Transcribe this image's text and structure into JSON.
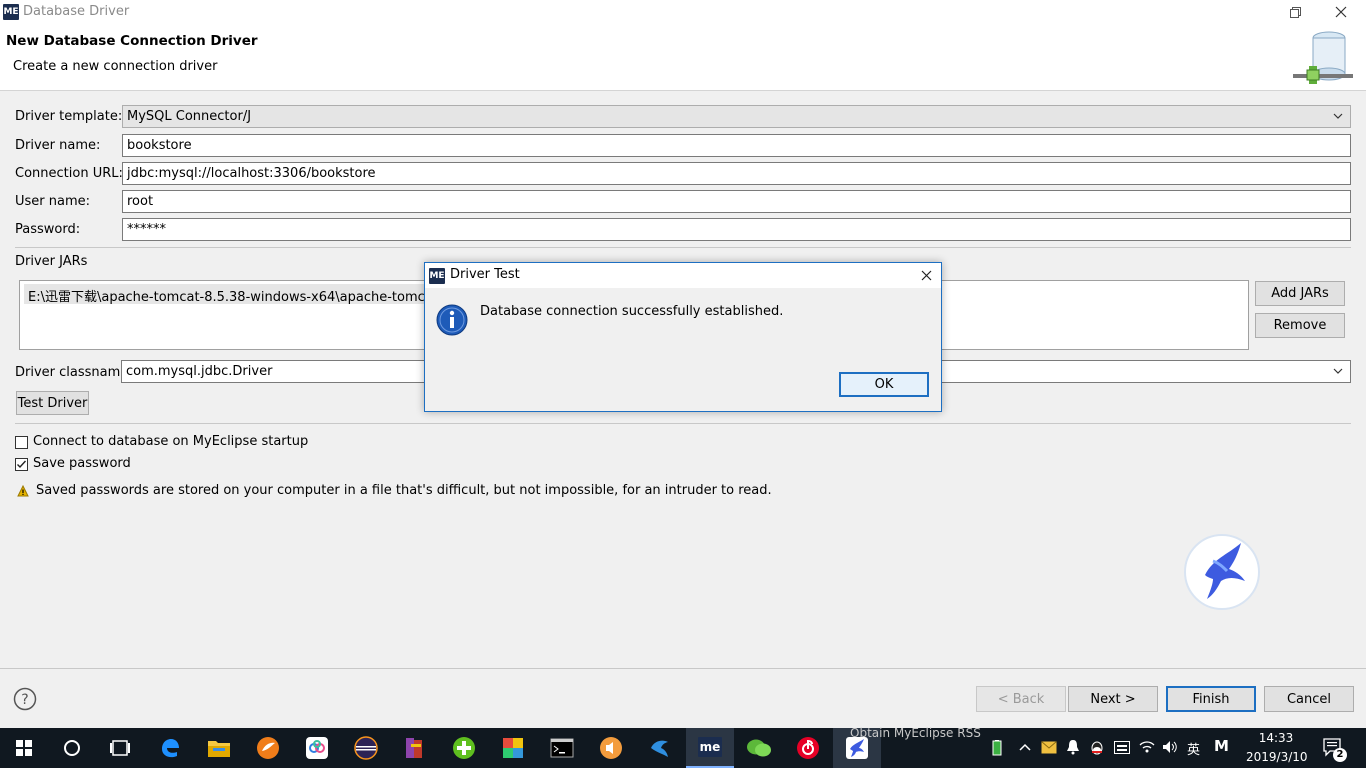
{
  "window": {
    "app_icon": "ME",
    "title": "Database Driver",
    "restore_icon": "restore-icon",
    "close_icon": "close-icon"
  },
  "header": {
    "title": "New Database Connection Driver",
    "subtitle": "Create a new connection driver"
  },
  "form": {
    "driver_template_label": "Driver template:",
    "driver_template_value": "MySQL Connector/J",
    "driver_name_label": "Driver name:",
    "driver_name_value": "bookstore",
    "connection_url_label": "Connection URL:",
    "connection_url_value": "jdbc:mysql://localhost:3306/bookstore",
    "user_name_label": "User name:",
    "user_name_value": "root",
    "password_label": "Password:",
    "password_value": "******",
    "driver_jars_label": "Driver JARs",
    "jars": [
      "E:\\迅雷下载\\apache-tomcat-8.5.38-windows-x64\\apache-tomcat-8.5.3"
    ],
    "add_jars_label": "Add JARs",
    "remove_label": "Remove",
    "driver_classname_label": "Driver classname:",
    "driver_classname_value": "com.mysql.jdbc.Driver",
    "test_driver_label": "Test Driver",
    "connect_on_startup_label": "Connect to database on MyEclipse startup",
    "connect_on_startup_checked": false,
    "save_password_label": "Save password",
    "save_password_checked": true,
    "warning_text": "Saved passwords are stored on your computer in a file that's difficult, but not impossible, for an intruder to read."
  },
  "dialog": {
    "title": "Driver Test",
    "message": "Database connection successfully established.",
    "ok_label": "OK"
  },
  "footer": {
    "back_label": "< Back",
    "next_label": "Next >",
    "finish_label": "Finish",
    "cancel_label": "Cancel"
  },
  "taskbar": {
    "notification_text": "Obtain MyEclipse RSS",
    "time": "14:33",
    "date": "2019/3/10",
    "ime": "英",
    "ime2": "M",
    "notification_count": "2",
    "active_app_label": "me"
  },
  "colors": {
    "accent": "#1d6fc2",
    "taskbar_bg": "#101820",
    "info_icon": "#1e5bb8",
    "warning": "#e6b400"
  }
}
